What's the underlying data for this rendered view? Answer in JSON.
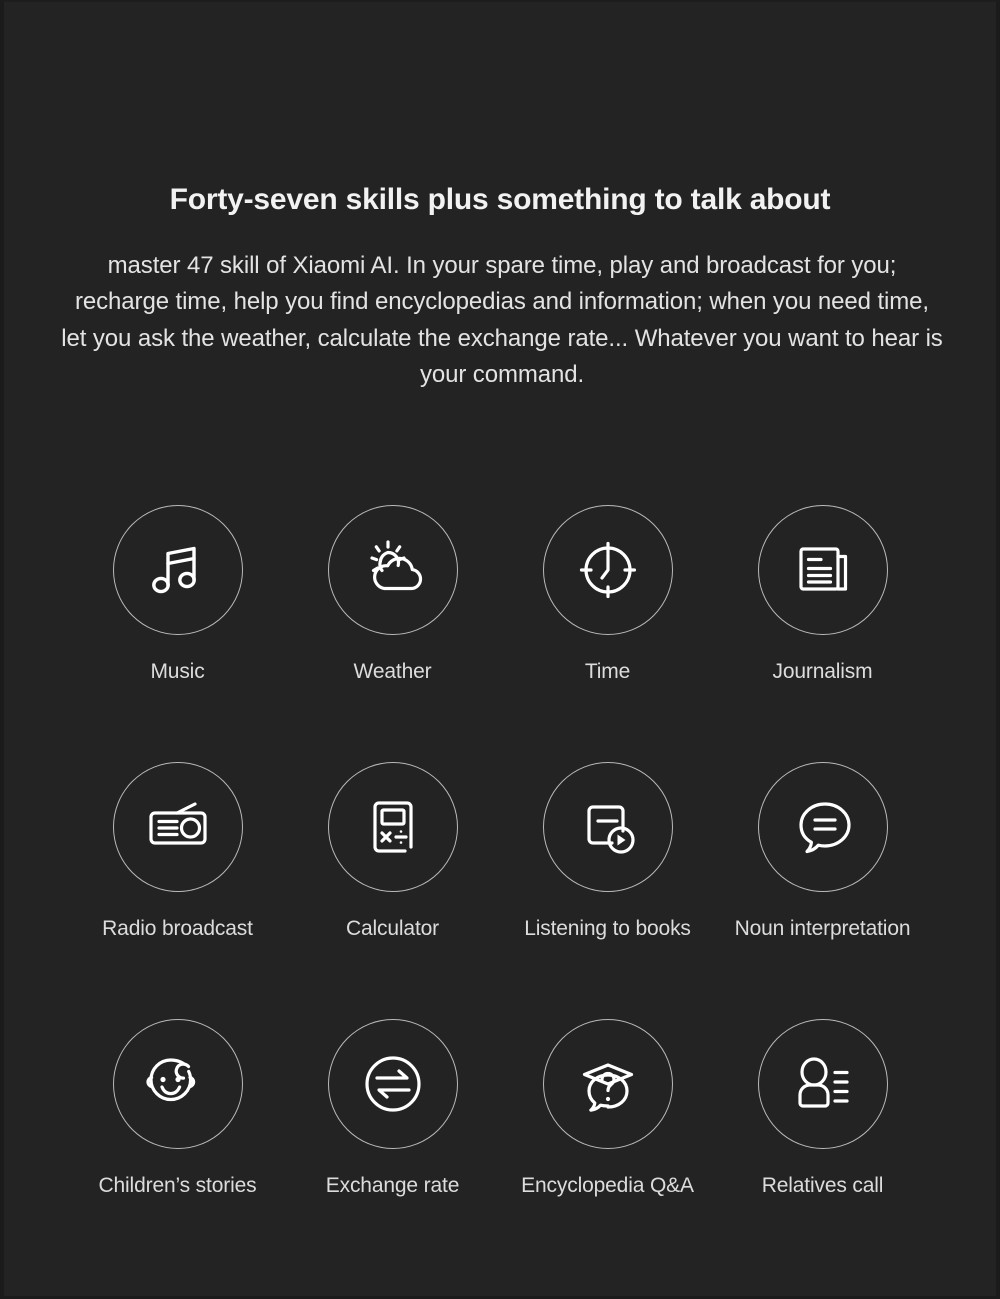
{
  "page": {
    "background_color": "#232323",
    "frame_color": "#1b1b1b",
    "text_color": "#e3e3e3",
    "accent_color": "#b9b9b9"
  },
  "heading": "Forty-seven skills plus something to talk about",
  "body_text": "master 47 skill of Xiaomi AI. In your spare time, play and broadcast for you; recharge time, help you find encyclopedias and information; when you need time, let you ask the weather, calculate the exchange rate... Whatever you want to hear is your command.",
  "skills": [
    {
      "label": "Music",
      "icon": "music-note-icon"
    },
    {
      "label": "Weather",
      "icon": "sun-behind-cloud-icon"
    },
    {
      "label": "Time",
      "icon": "clock-icon"
    },
    {
      "label": "Journalism",
      "icon": "newspaper-icon"
    },
    {
      "label": "Radio broadcast",
      "icon": "radio-icon"
    },
    {
      "label": "Calculator",
      "icon": "calculator-icon"
    },
    {
      "label": "Listening to books",
      "icon": "audiobook-play-icon"
    },
    {
      "label": "Noun interpretation",
      "icon": "speech-bubble-lines-icon"
    },
    {
      "label": "Children’s stories",
      "icon": "baby-face-icon"
    },
    {
      "label": "Exchange rate",
      "icon": "exchange-arrows-icon"
    },
    {
      "label": "Encyclopedia Q&A",
      "icon": "graduation-cap-question-icon"
    },
    {
      "label": "Relatives call",
      "icon": "contact-person-icon"
    }
  ]
}
